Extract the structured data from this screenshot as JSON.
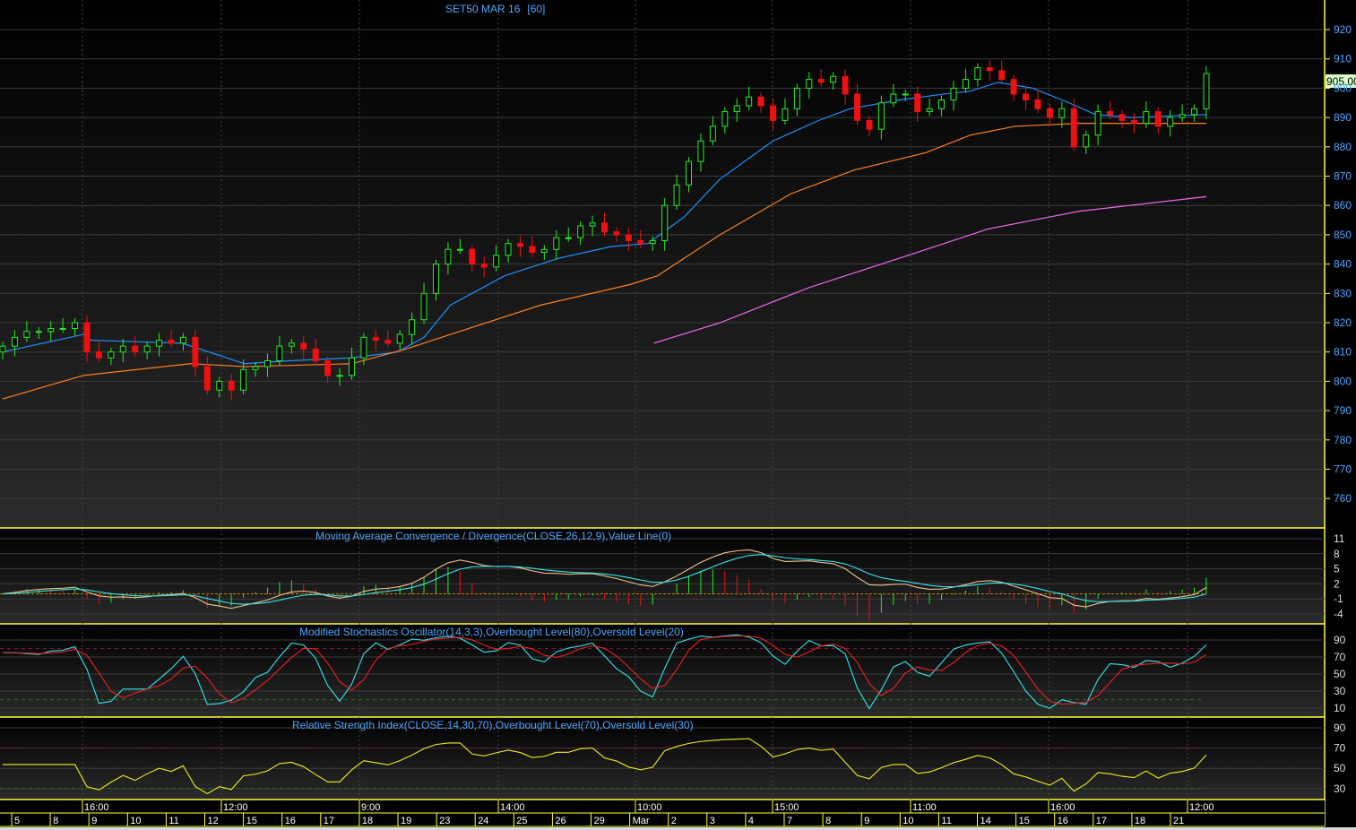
{
  "chart_data": [
    {
      "type": "candlestick",
      "title": "SET50 MAR 16",
      "interval": "[60]",
      "last_price_label": "905.00",
      "ylim": [
        755,
        925
      ],
      "yticks": [
        920,
        910,
        900,
        890,
        880,
        870,
        860,
        850,
        840,
        830,
        820,
        810,
        800,
        790,
        780,
        770,
        760
      ],
      "closes": [
        812,
        815,
        817,
        817,
        818,
        818,
        820,
        810,
        808,
        810,
        812,
        810,
        812,
        814,
        813,
        815,
        805,
        797,
        800,
        797,
        804,
        805,
        807,
        812,
        813,
        811,
        807,
        802,
        802,
        808,
        815,
        814,
        813,
        816,
        821,
        830,
        840,
        845,
        845,
        840,
        839,
        843,
        847,
        846,
        844,
        845,
        849,
        849,
        853,
        854,
        851,
        850,
        848,
        847,
        848,
        860,
        867,
        875,
        882,
        887,
        892,
        894,
        897,
        894,
        889,
        893,
        900,
        903,
        902,
        904,
        898,
        889,
        886,
        895,
        898,
        898,
        892,
        893,
        896,
        900,
        903,
        907,
        906,
        903,
        898,
        896,
        893,
        890,
        893,
        880,
        884,
        892,
        891,
        889,
        888,
        892,
        887,
        890,
        891,
        893,
        905
      ],
      "first_open": 810,
      "moving_averages": [
        {
          "name": "short MA",
          "color": "#1e90ff",
          "points": [
            [
              0,
              810
            ],
            [
              6.7,
              816
            ],
            [
              7.4,
              814
            ],
            [
              14.9,
              813
            ],
            [
              20.1,
              806
            ],
            [
              23.8,
              807
            ],
            [
              29,
              808
            ],
            [
              32.8,
              810
            ],
            [
              35,
              815
            ],
            [
              37.2,
              826
            ],
            [
              41.7,
              836
            ],
            [
              46.2,
              842
            ],
            [
              50.6,
              846
            ],
            [
              53.6,
              847
            ],
            [
              56.6,
              856
            ],
            [
              59.6,
              869
            ],
            [
              64,
              882
            ],
            [
              67.8,
              889
            ],
            [
              70.4,
              893
            ],
            [
              74.5,
              896
            ],
            [
              78.2,
              898
            ],
            [
              80.4,
              899
            ],
            [
              82.7,
              902
            ],
            [
              85.6,
              900
            ],
            [
              88.6,
              895
            ],
            [
              90.8,
              891
            ],
            [
              93.8,
              890
            ],
            [
              100,
              891
            ]
          ]
        },
        {
          "name": "medium MA",
          "color": "#ff7f1e",
          "points": [
            [
              0,
              794
            ],
            [
              6.7,
              802
            ],
            [
              15.6,
              806
            ],
            [
              20.1,
              805
            ],
            [
              29,
              806
            ],
            [
              33.5,
              811
            ],
            [
              38.7,
              818
            ],
            [
              44.7,
              826
            ],
            [
              52.1,
              833
            ],
            [
              54.4,
              836
            ],
            [
              59.6,
              850
            ],
            [
              65.5,
              864
            ],
            [
              70.7,
              872
            ],
            [
              76.7,
              878
            ],
            [
              80.4,
              884
            ],
            [
              84.1,
              887
            ],
            [
              89.4,
              888
            ],
            [
              100,
              888
            ]
          ]
        },
        {
          "name": "long MA",
          "color": "#ee66ee",
          "points": [
            [
              54.1,
              813
            ],
            [
              59.6,
              820
            ],
            [
              67,
              832
            ],
            [
              74.5,
              842
            ],
            [
              81.9,
              852
            ],
            [
              89.4,
              858
            ],
            [
              100,
              863
            ]
          ]
        }
      ]
    },
    {
      "type": "line",
      "title": "Moving Average Convergence / Divergence(CLOSE,26,12,9),Value Line(0)",
      "yticks": [
        11,
        8,
        5,
        2,
        -1,
        -4
      ],
      "ylim": [
        -6,
        13
      ],
      "series": [
        "MACD",
        "Signal",
        "Histogram"
      ]
    },
    {
      "type": "line",
      "title": "Modified Stochastics Oscillator(14,3,3),Overbought Level(80),Oversold Level(20)",
      "yticks": [
        90,
        70,
        50,
        30,
        10
      ],
      "overbought": 80,
      "oversold": 20
    },
    {
      "type": "line",
      "title": "Relative Strength Index(CLOSE,14,30,70),Overbought Level(70),Oversold Level(30)",
      "yticks": [
        90,
        70,
        50,
        30
      ],
      "overbought": 70,
      "oversold": 30
    }
  ],
  "time_axis": {
    "times": [
      "16:00",
      "12:00",
      "9:00",
      "14:00",
      "10:00",
      "15:00",
      "11:00",
      "16:00",
      "12:00"
    ],
    "dates": [
      "5",
      "8",
      "9",
      "10",
      "11",
      "12",
      "15",
      "16",
      "17",
      "18",
      "19",
      "23",
      "24",
      "25",
      "26",
      "29",
      "Mar",
      "2",
      "3",
      "4",
      "7",
      "8",
      "9",
      "10",
      "11",
      "14",
      "15",
      "16",
      "17",
      "18",
      "21"
    ]
  },
  "colors": {
    "up": "#22ee22",
    "down": "#ee1111",
    "axis": "#ffff33",
    "label": "#4da6ff",
    "cyan": "#33e5ee",
    "tan": "#f0c08a",
    "rsi": "#eeee22"
  }
}
